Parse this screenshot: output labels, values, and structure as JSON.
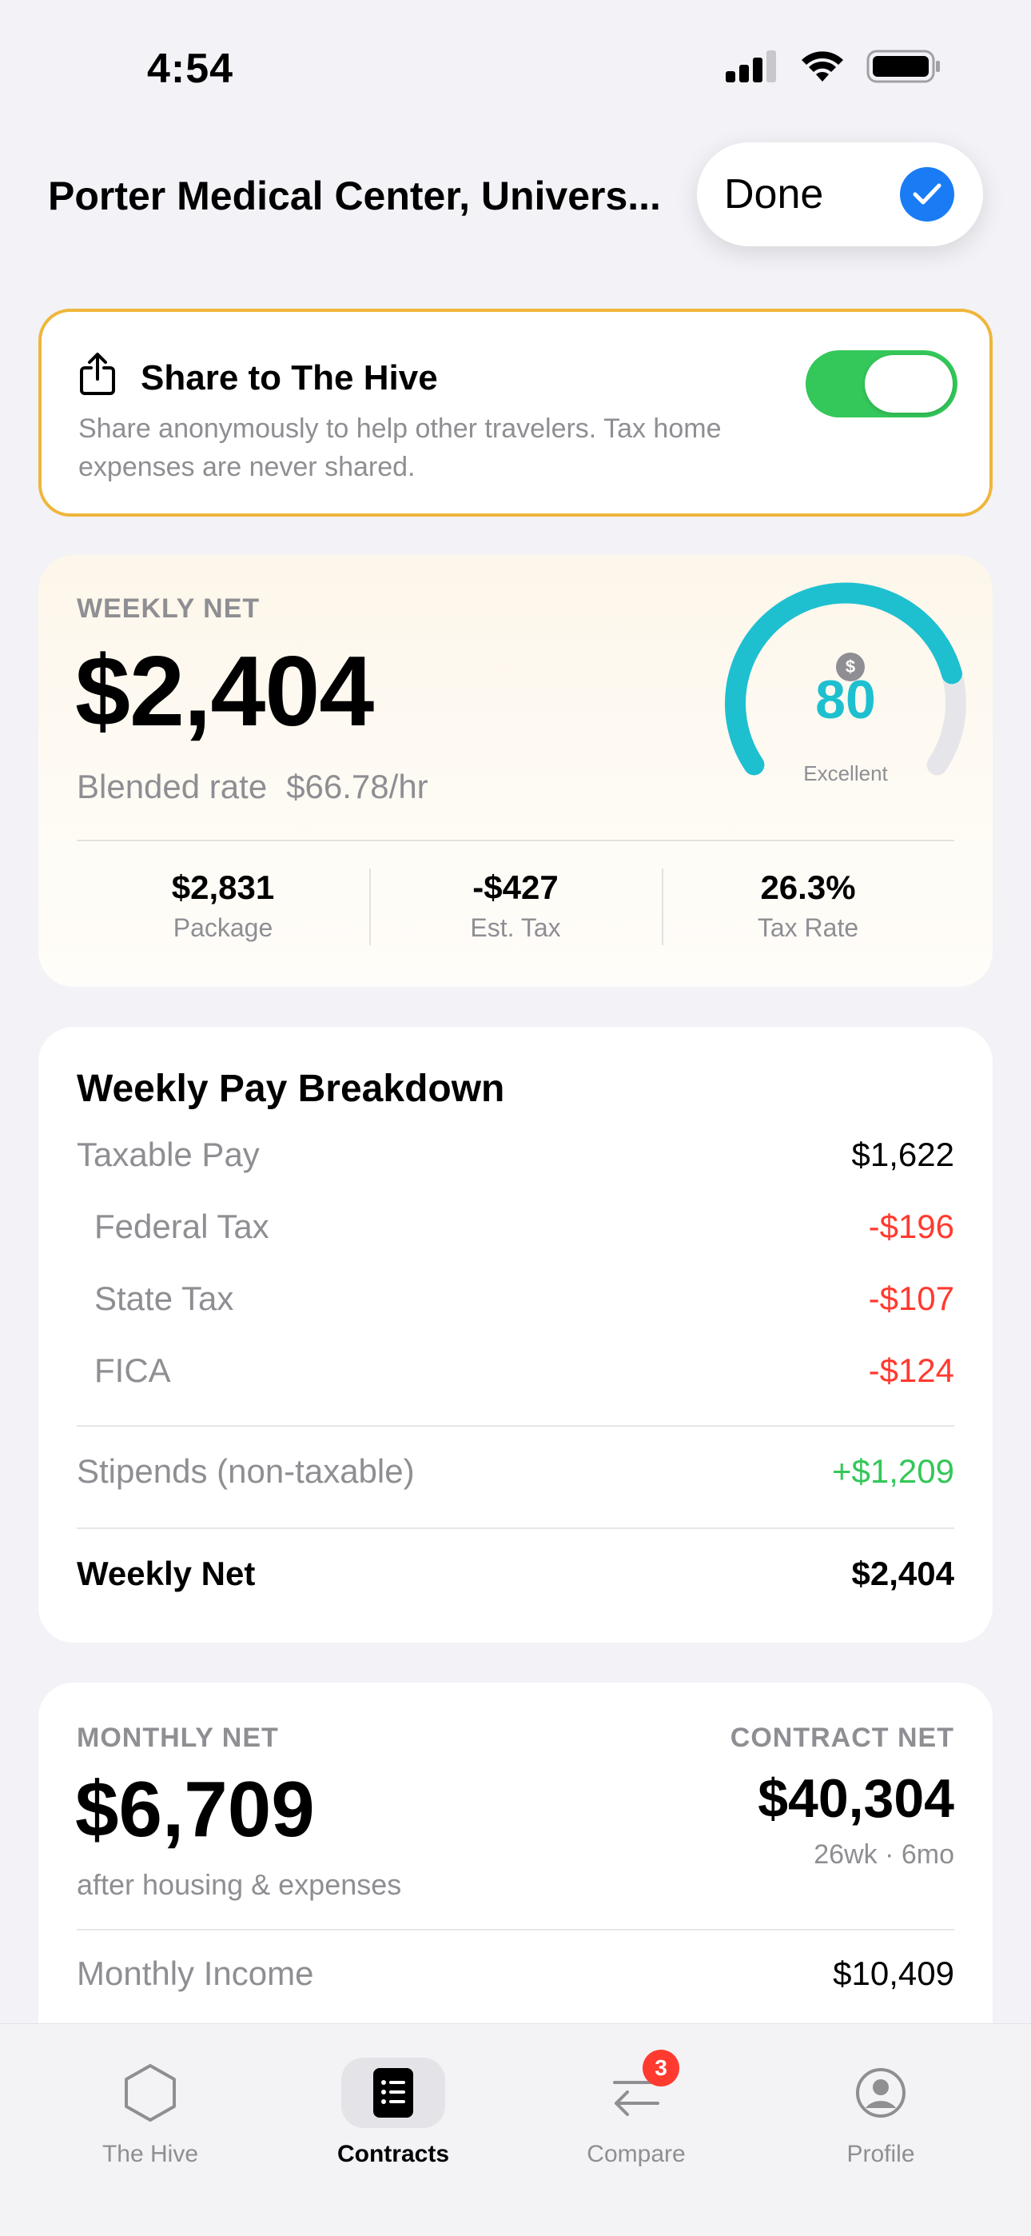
{
  "status_bar": {
    "time": "4:54"
  },
  "nav": {
    "title": "Porter Medical Center, Univers...",
    "done_label": "Done"
  },
  "share": {
    "title": "Share to The Hive",
    "description": "Share anonymously to help other travelers. Tax home expenses are never shared.",
    "enabled": true
  },
  "weekly_net": {
    "label": "WEEKLY NET",
    "amount": "$2,404",
    "rate_label": "Blended rate",
    "rate_value": "$66.78/hr",
    "score": "80",
    "score_fraction": 0.8,
    "score_label": "Excellent",
    "score_icon": "$",
    "stats": [
      {
        "value": "$2,831",
        "label": "Package"
      },
      {
        "value": "-$427",
        "label": "Est. Tax"
      },
      {
        "value": "26.3%",
        "label": "Tax Rate"
      }
    ]
  },
  "breakdown": {
    "title": "Weekly Pay Breakdown",
    "rows": [
      {
        "label": "Taxable Pay",
        "value": "$1,622"
      },
      {
        "label": "Federal Tax",
        "value": "-$196"
      },
      {
        "label": "State Tax",
        "value": "-$107"
      },
      {
        "label": "FICA",
        "value": "-$124"
      },
      {
        "label": "Stipends (non-taxable)",
        "value": "+$1,209"
      },
      {
        "label": "Weekly Net",
        "value": "$2,404"
      }
    ]
  },
  "monthly": {
    "label": "MONTHLY NET",
    "amount": "$6,709",
    "sub": "after housing & expenses",
    "contract_label": "CONTRACT NET",
    "contract_amount": "$40,304",
    "contract_sub": "26wk · 6mo",
    "income_label": "Monthly Income",
    "income_value": "$10,409"
  },
  "tabs": [
    {
      "label": "The Hive",
      "icon": "hexagon-icon"
    },
    {
      "label": "Contracts",
      "icon": "document-list-icon"
    },
    {
      "label": "Compare",
      "icon": "arrows-swap-icon",
      "badge": "3"
    },
    {
      "label": "Profile",
      "icon": "person-circle-icon"
    }
  ],
  "colors": {
    "accent": "#1a7cf5",
    "toggle_on": "#34c759",
    "gauge": "#1ec0d0",
    "negative": "#ff3b30",
    "positive": "#34c759",
    "share_border": "#f0b63a"
  }
}
